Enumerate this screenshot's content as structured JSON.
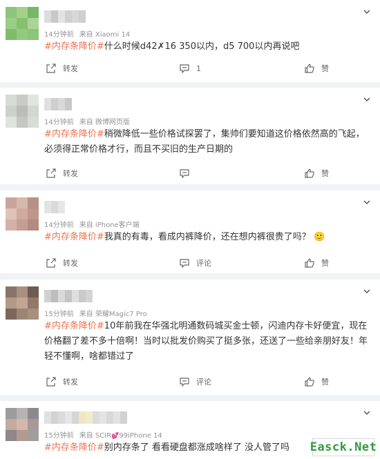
{
  "colors": {
    "topic": "#eb7350",
    "meta": "#939393",
    "background": "#f1f2f5",
    "card": "#ffffff",
    "watermark": "#2e9d3c"
  },
  "icons": {
    "menu": "chevron-down-icon",
    "share": "share-icon",
    "comment": "comment-icon",
    "like": "thumb-up-icon"
  },
  "posts": [
    {
      "time": "14分钟前",
      "source_prefix": "来自",
      "source": "Xiaomi 14",
      "topic": "#内存条降价#",
      "text": "什么时候d42✗16 350以内，d5 700以内再说吧",
      "share_label": "转发",
      "comment_label": "1",
      "like_label": "赞"
    },
    {
      "time": "14分钟前",
      "source_prefix": "来自",
      "source": "微博网页版",
      "topic": "#内存条降价#",
      "text": "稍微降低一些价格试探罢了，集帅们要知道这价格依然高的飞起，必须得正常价格才行，而且不买旧的生产日期的",
      "share_label": "转发",
      "comment_label": "",
      "like_label": "赞"
    },
    {
      "time": "14分钟前",
      "source_prefix": "来自",
      "source": "iPhone客户端",
      "topic": "#内存条降价#",
      "text": "我真的有毒，看成内裤降价，还在想内裤很贵了吗？",
      "emoji": "🙂",
      "share_label": "转发",
      "comment_label": "评论",
      "like_label": "赞"
    },
    {
      "time": "15分钟前",
      "source_prefix": "来自",
      "source": "荣耀Magic7 Pro",
      "topic": "#内存条降价#",
      "text": "10年前我在华强北明通数码城买金士顿，闪迪内存卡好便宜，现在价格翻了差不多十倍啊！当时以批发价购买了挺多张，还送了一些给亲朋好友！年轻不懂啊，啥都错过了",
      "share_label": "转发",
      "comment_label": "评论",
      "like_label": "赞"
    },
    {
      "time": "15分钟前",
      "source_prefix": "来自",
      "source": "SCIR",
      "source_suffix": "99iPhone 14",
      "topic": "#内存条降价#",
      "text": "别内存条了 看看硬盘都涨成啥样了 没人管了吗"
    }
  ],
  "watermark": "Easck.Net"
}
